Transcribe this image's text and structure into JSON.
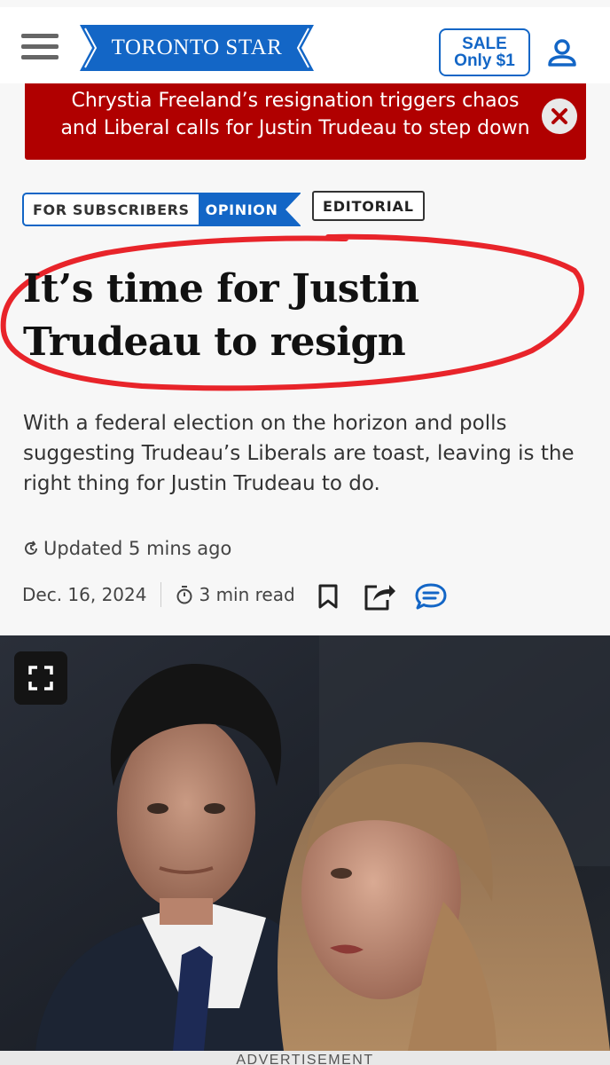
{
  "header": {
    "logo_text": "TORONTO STAR",
    "sale_line1": "SALE",
    "sale_line2": "Only $1",
    "colors": {
      "brand": "#1366c6",
      "alert": "#b00000"
    }
  },
  "alert": {
    "text": "Chrystia Freeland’s resignation triggers chaos and Liberal calls for Justin Trudeau to step down"
  },
  "tags": {
    "subscribers": "FOR SUBSCRIBERS",
    "opinion": "OPINION",
    "editorial": "EDITORIAL"
  },
  "article": {
    "headline": "It’s time for Justin Trudeau to resign",
    "deck": "With a federal election on the horizon and polls suggesting Trudeau’s Liberals are toast, leaving is the right thing for Justin Trudeau to do.",
    "updated": "Updated 5 mins ago",
    "date": "Dec. 16, 2024",
    "read_time": "3 min read"
  },
  "icons": [
    "hamburger-menu-icon",
    "user-icon",
    "close-icon",
    "refresh-icon",
    "timer-icon",
    "bookmark-icon",
    "share-icon",
    "comment-icon",
    "expand-icon"
  ],
  "ad": {
    "label": "ADVERTISEMENT"
  }
}
